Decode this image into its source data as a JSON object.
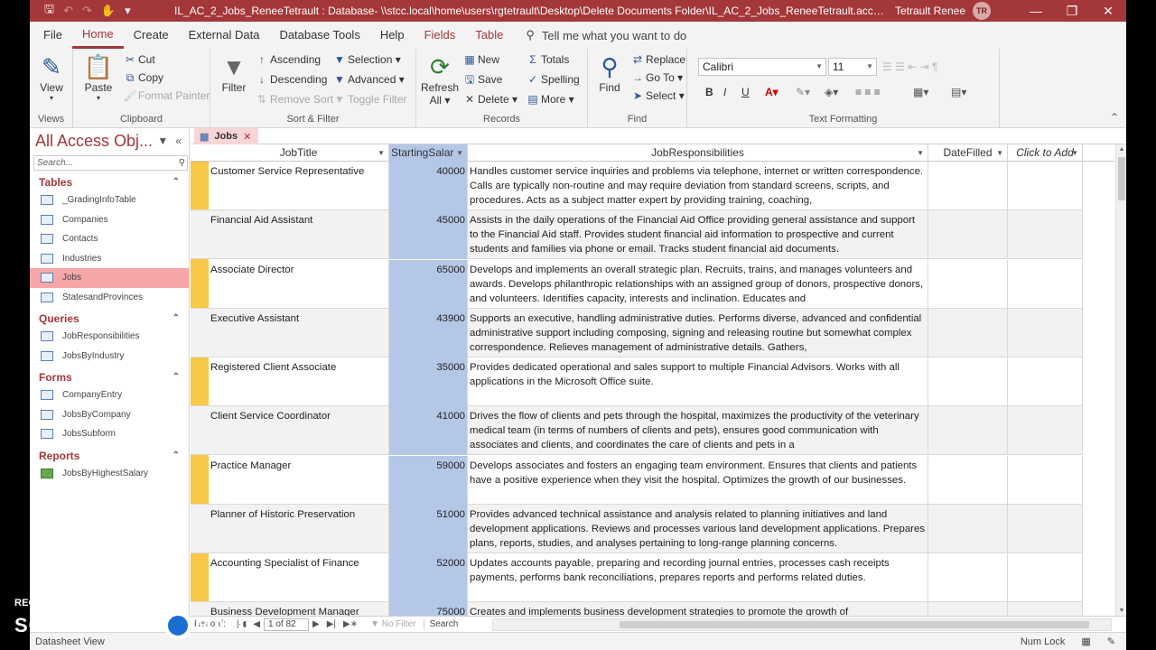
{
  "titlebar": {
    "title": "IL_AC_2_Jobs_ReneeTetrault : Database- \\\\stcc.local\\home\\users\\rgtetrault\\Desktop\\Delete Documents Folder\\IL_AC_2_Jobs_ReneeTetrault.accdb (Access 2007 - 2...",
    "user": "Tetrault Renee",
    "initials": "TR"
  },
  "tabs": [
    "File",
    "Home",
    "Create",
    "External Data",
    "Database Tools",
    "Help",
    "Fields",
    "Table"
  ],
  "tellme": "Tell me what you want to do",
  "ribbon": {
    "views": {
      "label": "Views",
      "view": "View"
    },
    "clipboard": {
      "label": "Clipboard",
      "paste": "Paste",
      "cut": "Cut",
      "copy": "Copy",
      "format_painter": "Format Painter"
    },
    "sortfilter": {
      "label": "Sort & Filter",
      "filter": "Filter",
      "ascending": "Ascending",
      "descending": "Descending",
      "remove_sort": "Remove Sort",
      "selection": "Selection",
      "advanced": "Advanced",
      "toggle_filter": "Toggle Filter"
    },
    "records": {
      "label": "Records",
      "refresh": "Refresh",
      "refresh_all": "All",
      "new": "New",
      "save": "Save",
      "delete": "Delete",
      "totals": "Totals",
      "spelling": "Spelling",
      "more": "More"
    },
    "find": {
      "label": "Find",
      "find": "Find",
      "replace": "Replace",
      "goto": "Go To",
      "select": "Select"
    },
    "text": {
      "label": "Text Formatting",
      "font": "Calibri",
      "size": "11"
    }
  },
  "nav": {
    "title": "All Access Obj...",
    "search_placeholder": "Search...",
    "groups": [
      {
        "name": "Tables",
        "items": [
          "_GradingInfoTable",
          "Companies",
          "Contacts",
          "Industries",
          "Jobs",
          "StatesandProvinces"
        ]
      },
      {
        "name": "Queries",
        "items": [
          "JobResponsibilities",
          "JobsByIndustry"
        ]
      },
      {
        "name": "Forms",
        "items": [
          "CompanyEntry",
          "JobsByCompany",
          "JobsSubform"
        ]
      },
      {
        "name": "Reports",
        "items": [
          "JobsByHighestSalary"
        ]
      }
    ],
    "selected": "Jobs"
  },
  "doc_tab": "Jobs",
  "grid": {
    "columns": [
      "JobTitle",
      "StartingSalar",
      "JobResponsibilities",
      "DateFilled",
      "Click to Add"
    ],
    "rows": [
      {
        "title": "Customer Service Representative",
        "salary": "40000",
        "resp": "Handles customer service inquiries and problems via telephone, internet or written correspondence. Calls are typically non-routine and may require deviation from standard screens, scripts, and procedures. Acts as a subject matter expert by providing training, coaching,"
      },
      {
        "title": "Financial Aid Assistant",
        "salary": "45000",
        "resp": "Assists in the daily operations of the Financial Aid Office providing general assistance and support to the Financial Aid staff. Provides student financial aid information to prospective and current students and families via phone or email. Tracks student financial aid documents."
      },
      {
        "title": "Associate Director",
        "salary": "65000",
        "resp": "Develops and implements an overall strategic plan.  Recruits, trains, and manages volunteers and awards.  Develops philanthropic relationships with an assigned group of donors, prospective donors, and volunteers. Identifies capacity, interests and inclination.  Educates and"
      },
      {
        "title": "Executive Assistant",
        "salary": "43900",
        "resp": "Supports an executive, handling administrative duties. Performs diverse, advanced and confidential administrative support including composing, signing and releasing routine but somewhat complex correspondence. Relieves management of administrative details. Gathers,"
      },
      {
        "title": "Registered Client Associate",
        "salary": "35000",
        "resp": "Provides dedicated operational and sales support to multiple Financial Advisors. Works with all applications in the Microsoft Office suite."
      },
      {
        "title": "Client Service Coordinator",
        "salary": "41000",
        "resp": "Drives the flow of clients and pets through the hospital, maximizes the productivity of the veterinary medical team (in terms of numbers of clients and pets), ensures good communication with associates and clients, and coordinates the care of clients and pets in a"
      },
      {
        "title": "Practice Manager",
        "salary": "59000",
        "resp": "Develops associates and fosters an engaging team environment. Ensures that clients and patients have a positive experience when they visit the hospital. Optimizes the growth of our businesses."
      },
      {
        "title": "Planner of Historic Preservation",
        "salary": "51000",
        "resp": "Provides advanced technical assistance and analysis related to planning initiatives and land development applications. Reviews and processes various land development applications. Prepares plans, reports, studies, and analyses pertaining to long-range planning concerns."
      },
      {
        "title": "Accounting Specialist of Finance",
        "salary": "52000",
        "resp": "Updates accounts payable, preparing and recording journal entries, processes cash receipts payments, performs bank reconciliations, prepares reports and performs related duties."
      },
      {
        "title": "Business Development Manager",
        "salary": "75000",
        "resp": "Creates and implements business development strategies to promote the growth of"
      }
    ]
  },
  "recnav": {
    "label": "Record:",
    "current": "1 of 82",
    "no_filter": "No Filter",
    "search": "Search"
  },
  "status": {
    "left": "Datasheet View",
    "num_lock": "Num Lock"
  },
  "watermark": {
    "line1": "RECORDED WITH",
    "line2a": "SCREENCAST",
    "line2b": "MATIC"
  },
  "colors": {
    "accent": "#a4373a",
    "selected_col": "#b4c7e7",
    "record_selector": "#f9c846"
  }
}
